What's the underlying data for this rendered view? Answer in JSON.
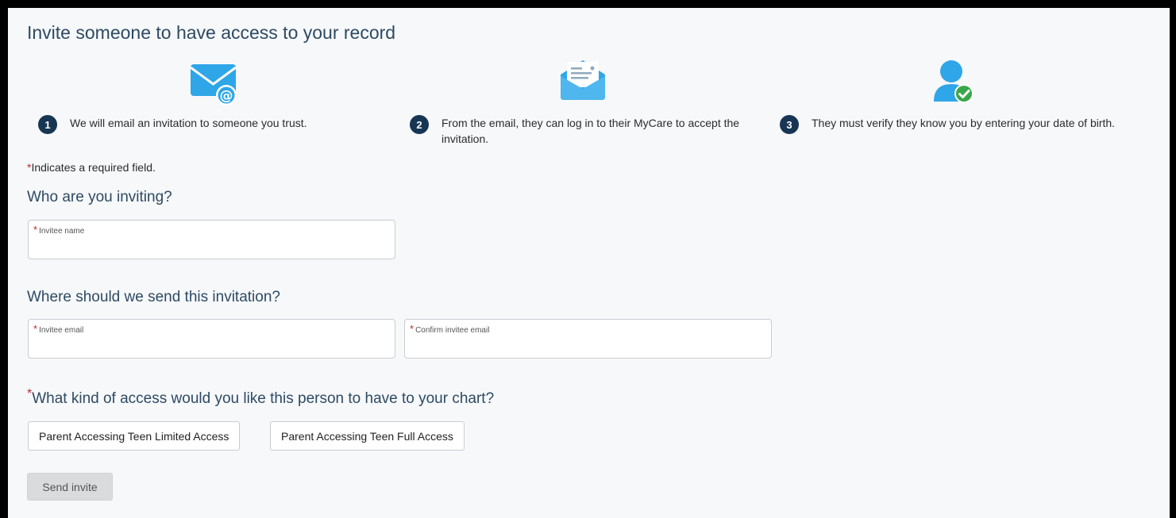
{
  "page": {
    "title": "Invite someone to have access to your record"
  },
  "steps": [
    {
      "number": "1",
      "icon": "email-at-icon",
      "text": "We will email an invitation to someone you trust."
    },
    {
      "number": "2",
      "icon": "open-envelope-icon",
      "text": "From the email, they can log in to their MyCare to accept the invitation."
    },
    {
      "number": "3",
      "icon": "user-verified-icon",
      "text": "They must verify they know you by entering your date of birth."
    }
  ],
  "required_note": {
    "star": "*",
    "text": "Indicates a required field."
  },
  "invitee_section": {
    "heading": "Who are you inviting?",
    "name_label": "Invitee name",
    "name_value": ""
  },
  "email_section": {
    "heading": "Where should we send this invitation?",
    "email_label": "Invitee email",
    "email_value": "",
    "confirm_label": "Confirm invitee email",
    "confirm_value": ""
  },
  "access_section": {
    "heading": "What kind of access would you like this person to have to your chart?",
    "options": [
      "Parent Accessing Teen Limited Access",
      "Parent Accessing Teen Full Access"
    ]
  },
  "actions": {
    "send_label": "Send invite"
  },
  "colors": {
    "heading": "#2e4a63",
    "step_badge": "#173653",
    "icon_blue": "#2fa6e8",
    "check_green": "#3aa64b",
    "required_star": "#c0282d",
    "disabled_button": "#d9dbdd"
  }
}
